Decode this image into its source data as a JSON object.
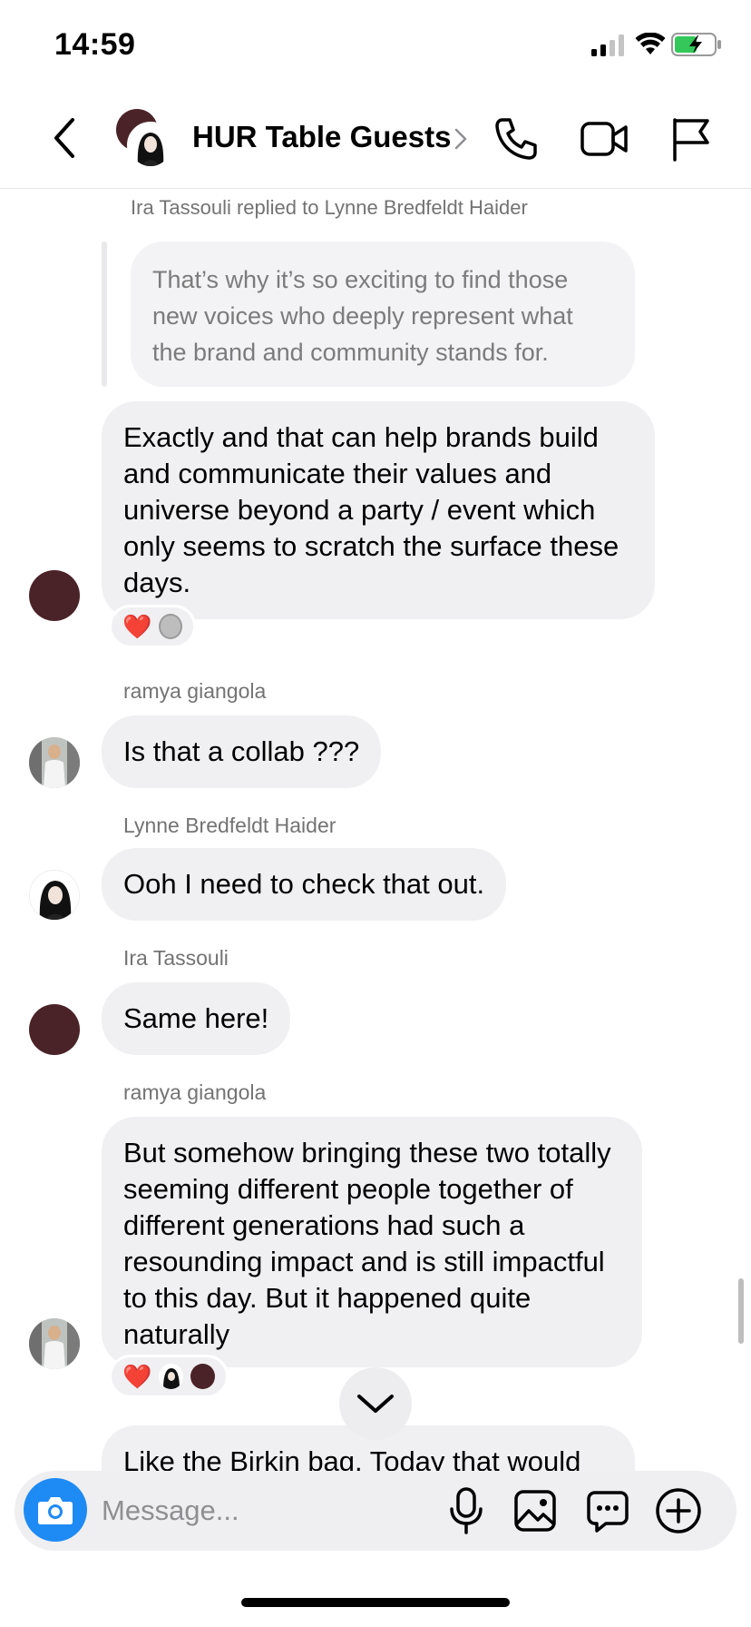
{
  "status_bar": {
    "time": "14:59"
  },
  "header": {
    "title": "HUR Table Guests"
  },
  "messages": {
    "reply": {
      "context": "Ira Tassouli replied to Lynne Bredfeldt Haider",
      "quoted_text": "That’s why it’s so exciting to find those new voices who deeply represent what the brand and community stands for.",
      "text": "Exactly and that can help brands build and communicate their values and universe beyond a party / event which only seems to scratch the surface these days.",
      "reaction": "❤️"
    },
    "m1": {
      "sender": "ramya giangola",
      "text": "Is that a collab ???"
    },
    "m2": {
      "sender": "Lynne Bredfeldt Haider",
      "text": "Ooh I need to check that out."
    },
    "m3": {
      "sender": "Ira Tassouli",
      "text": "Same here!"
    },
    "m4": {
      "sender": "ramya giangola",
      "text": "But somehow bringing these two totally seeming different people together of different generations had such a resounding impact and is still impactful to this day. But it happened quite naturally",
      "reaction": "❤️"
    },
    "m5": {
      "text": "Like the Birkin bag. Today that would"
    }
  },
  "composer": {
    "placeholder": "Message..."
  },
  "icons": {
    "back": "chevron-left-icon",
    "call": "phone-icon",
    "video": "video-camera-icon",
    "flag": "flag-icon",
    "camera": "camera-icon",
    "mic": "microphone-icon",
    "gallery": "image-icon",
    "sticker": "chat-bubble-icon",
    "plus": "plus-circle-icon",
    "scroll_down": "chevron-down-icon"
  },
  "colors": {
    "bubble": "#f0f0f2",
    "accent": "#1e8af4",
    "maroon_avatar": "#4a2328",
    "secondary_text": "#737373"
  }
}
